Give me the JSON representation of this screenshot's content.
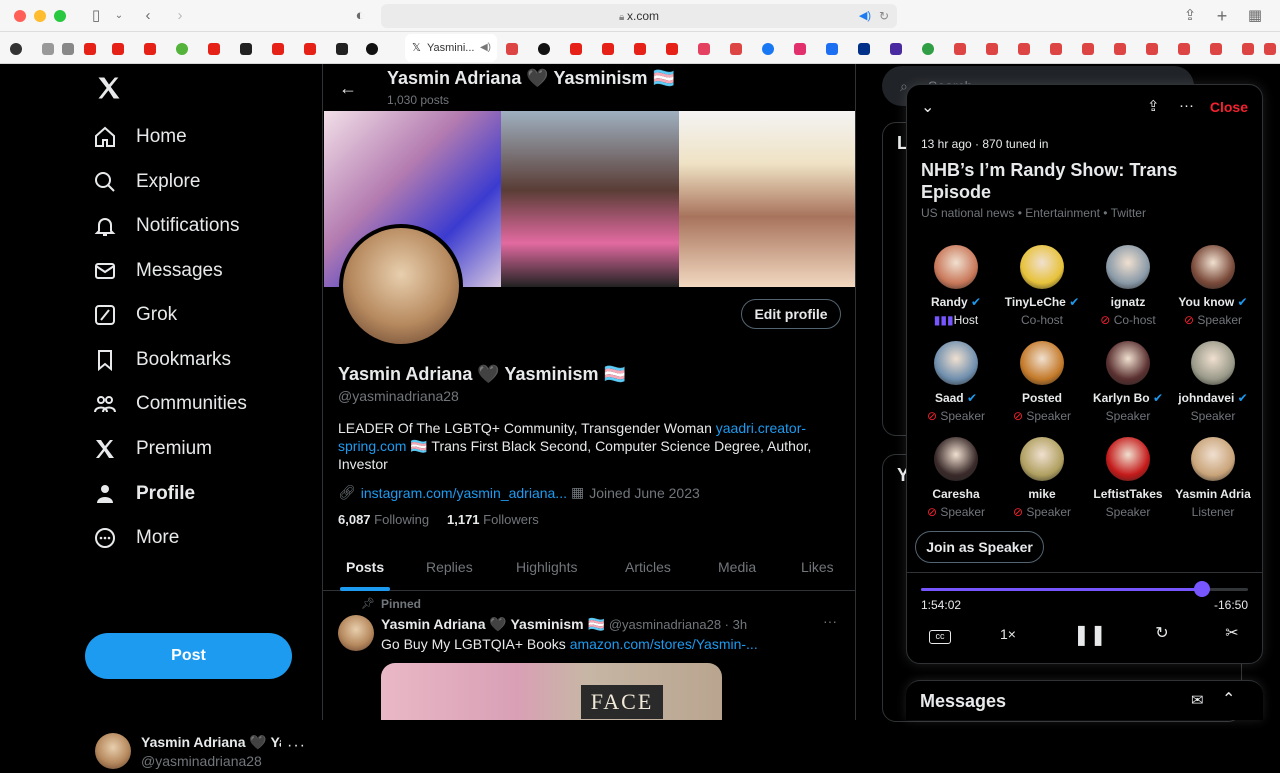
{
  "browser": {
    "url": "x.com",
    "active_tab_label": "Yasmini..."
  },
  "nav": {
    "items": [
      {
        "label": "Home",
        "icon": "home-icon"
      },
      {
        "label": "Explore",
        "icon": "search-icon"
      },
      {
        "label": "Notifications",
        "icon": "bell-icon"
      },
      {
        "label": "Messages",
        "icon": "mail-icon"
      },
      {
        "label": "Grok",
        "icon": "grok-icon"
      },
      {
        "label": "Bookmarks",
        "icon": "bookmark-icon"
      },
      {
        "label": "Communities",
        "icon": "people-icon"
      },
      {
        "label": "Premium",
        "icon": "x-logo-icon"
      },
      {
        "label": "Profile",
        "icon": "person-icon"
      },
      {
        "label": "More",
        "icon": "more-circle-icon"
      }
    ],
    "post_label": "Post",
    "account": {
      "name": "Yasmin Adriana 🖤 Ya",
      "handle": "@yasminadriana28"
    }
  },
  "profile": {
    "header_title": "Yasmin Adriana 🖤 Yasminism 🏳️‍⚧️",
    "post_count": "1,030 posts",
    "edit_label": "Edit profile",
    "name": "Yasmin Adriana 🖤 Yasminism 🏳️‍⚧️",
    "handle": "@yasminadriana28",
    "bio_prefix": "LEADER Of The LGBTQ+ Community, Transgender Woman ",
    "bio_link": "yaadri.creator-spring.com",
    "bio_suffix": " 🏳️‍⚧️ Trans First Black Second, Computer Science Degree, Author, Investor",
    "website": "instagram.com/yasmin_adriana...",
    "joined": "Joined June 2023",
    "following_count": "6,087",
    "following_label": "Following",
    "followers_count": "1,171",
    "followers_label": "Followers",
    "tabs": [
      "Posts",
      "Replies",
      "Highlights",
      "Articles",
      "Media",
      "Likes"
    ],
    "pinned_label": "Pinned",
    "tweet": {
      "name": "Yasmin Adriana 🖤 Yasminism 🏳️‍⚧️",
      "handle_time": "@yasminadriana28 · 3h",
      "text": "Go Buy My LGBTQIA+ Books ",
      "link": "amazon.com/stores/Yasmin-...",
      "image_text": "FACE"
    }
  },
  "right": {
    "search_placeholder": "Search",
    "messages_label": "Messages"
  },
  "space": {
    "meta": "13 hr ago · 870 tuned in",
    "title": "NHB’s I’m Randy Show: Trans Episode",
    "topics": "US national news • Entertainment • Twitter",
    "close_label": "Close",
    "participants": [
      {
        "name": "Randy",
        "role": "Host",
        "verified": true,
        "muted": false,
        "color": "#c9785a"
      },
      {
        "name": "TinyLeChe",
        "role": "Co-host",
        "verified": true,
        "muted": false,
        "color": "#e7c23a"
      },
      {
        "name": "ignatz",
        "role": "Co-host",
        "verified": false,
        "muted": true,
        "color": "#8a9aa8"
      },
      {
        "name": "You know",
        "role": "Speaker",
        "verified": true,
        "muted": true,
        "color": "#7a4a3a"
      },
      {
        "name": "Saad",
        "role": "Speaker",
        "verified": true,
        "muted": true,
        "color": "#6f8fae"
      },
      {
        "name": "Posted",
        "role": "Speaker",
        "verified": false,
        "muted": true,
        "color": "#c47a2a"
      },
      {
        "name": "Karlyn Bo",
        "role": "Speaker",
        "verified": true,
        "muted": false,
        "color": "#5a3030"
      },
      {
        "name": "johndavei",
        "role": "Speaker",
        "verified": true,
        "muted": false,
        "color": "#9a9a8a"
      },
      {
        "name": "Caresha",
        "role": "Speaker",
        "verified": false,
        "muted": true,
        "color": "#3a2a2a"
      },
      {
        "name": "mike",
        "role": "Speaker",
        "verified": false,
        "muted": true,
        "color": "#b0a060"
      },
      {
        "name": "LeftistTakes",
        "role": "Speaker",
        "verified": false,
        "muted": false,
        "color": "#c41a1a"
      },
      {
        "name": "Yasmin Adria",
        "role": "Listener",
        "verified": false,
        "muted": false,
        "color": "#c9a47a"
      }
    ],
    "join_label": "Join as Speaker",
    "progress": 0.86,
    "elapsed": "1:54:02",
    "remaining": "-16:50",
    "speed": "1×"
  },
  "colors": {
    "accent": "#1d9bf0",
    "space_purple": "#7856ff",
    "close_red": "#f4212e"
  }
}
